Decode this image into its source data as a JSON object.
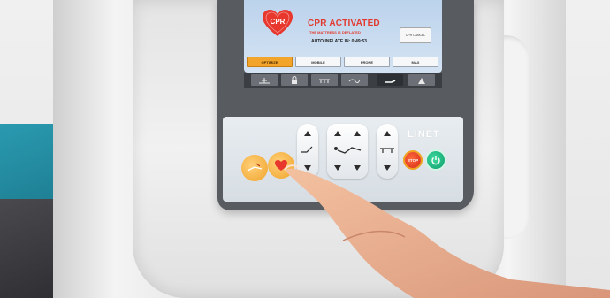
{
  "screen": {
    "heart_label": "CPR",
    "title": "CPR ACTIVATED",
    "subtitle": "THE MATTRESS IS DEFLATED",
    "auto_inflate": "AUTO INFLATE IN: 0:49:53",
    "cancel_button": "CPR CANCEL",
    "mode_tabs": [
      {
        "label": "OPTIMIZE",
        "active": true
      },
      {
        "label": "MOBILE",
        "active": false
      },
      {
        "label": "PRONE",
        "active": false
      },
      {
        "label": "MAX",
        "active": false
      }
    ]
  },
  "function_bar": {
    "icons": [
      "weigh-icon",
      "lock-icon",
      "mattress-icon",
      "heel-icon",
      "flat-bed-icon",
      "tent-icon"
    ],
    "active_index": 4
  },
  "control_panel": {
    "brand": "LINET",
    "stop_label": "STOP",
    "colors": {
      "accent": "#f0a32a",
      "stop": "#d42a14",
      "power": "#0b9a6a",
      "screen": "#c9dcf0"
    }
  }
}
